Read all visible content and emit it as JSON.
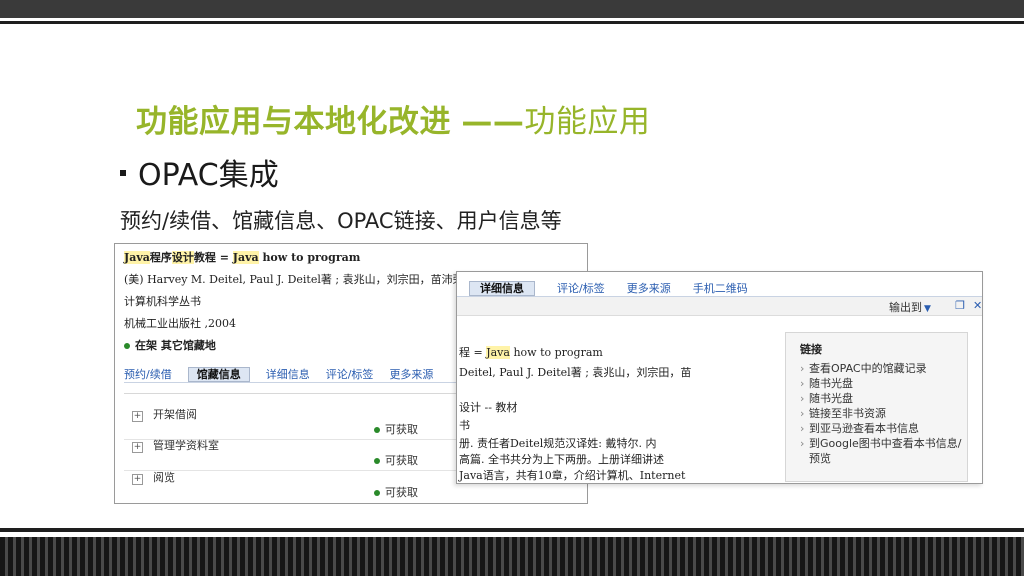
{
  "slide": {
    "title_bold": "功能应用与本地化改进",
    "title_dash": "——",
    "title_rest": "功能应用",
    "bullet": "OPAC集成",
    "subline": "预约/续借、馆藏信息、OPAC链接、用户信息等"
  },
  "shot1": {
    "title_hl1": "Java",
    "title_mid1": "程序",
    "title_hl2": "设计",
    "title_mid2": "教程 = ",
    "title_hl3": "Java",
    "title_rest": " how to program",
    "authors": "(美) Harvey M. Deitel, Paul J. Deitel著 ; 袁兆山，刘宗田，苗沛荣等",
    "series": "计算机科学丛书",
    "publisher": "机械工业出版社 ,2004",
    "status": "在架 其它馆藏地",
    "tabs": [
      "预约/续借",
      "馆藏信息",
      "详细信息",
      "评论/标签",
      "更多来源"
    ],
    "active_tab": "馆藏信息",
    "holdings": [
      {
        "name": "开架借阅",
        "status": "可获取"
      },
      {
        "name": "管理学资料室",
        "status": "可获取"
      },
      {
        "name": "阅览",
        "status": "可获取"
      }
    ]
  },
  "shot2": {
    "tabs": [
      "详细信息",
      "评论/标签",
      "更多来源",
      "手机二维码"
    ],
    "active_tab": "详细信息",
    "export_label": "输出到",
    "lines": [
      {
        "a": "程 = ",
        "hl": "Java",
        "b": " how to program"
      },
      {
        "a": "Deitel, Paul J. Deitel著 ; 袁兆山，刘宗田，苗",
        "hl": "",
        "b": ""
      },
      {
        "a": "设计 -- 教材",
        "hl": "",
        "b": ""
      },
      {
        "a": "书",
        "hl": "",
        "b": ""
      },
      {
        "a": "册. 责任者Deitel规范汉译姓: 戴特尔. 内",
        "hl": "",
        "b": ""
      },
      {
        "a": "高篇. 全书共分为上下两册。上册详细讲述",
        "hl": "",
        "b": ""
      },
      {
        "a": "Java语言，共有10章，介绍计算机、Internet",
        "hl": "",
        "b": ""
      }
    ],
    "links_title": "链接",
    "links": [
      "查看OPAC中的馆藏记录",
      "随书光盘",
      "随书光盘",
      "链接至非书资源",
      "到亚马逊查看本书信息",
      "到Google图书中查看本书信息/预览"
    ]
  },
  "colors": {
    "title_green": "#97b52a",
    "link_blue": "#2a5db0",
    "available_green": "#2a8a2a"
  }
}
